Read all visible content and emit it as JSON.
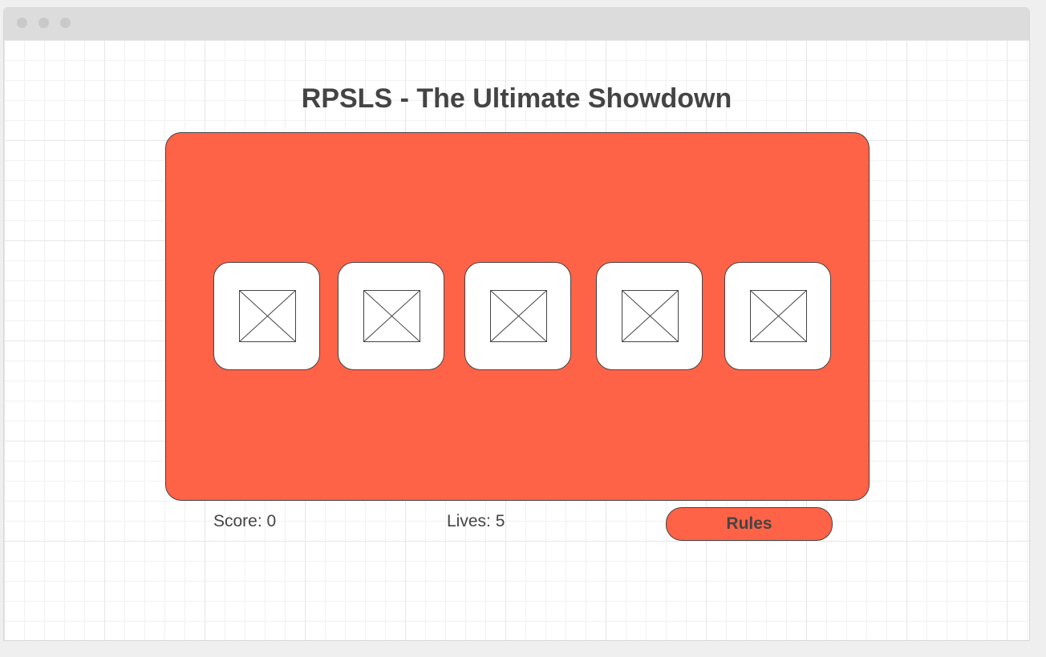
{
  "page": {
    "title": "RPSLS - The Ultimate Showdown"
  },
  "colors": {
    "accent": "#ff6347",
    "text": "#444444",
    "card": "#ffffff"
  },
  "board": {
    "choices": [
      {
        "icon": "image-placeholder-icon"
      },
      {
        "icon": "image-placeholder-icon"
      },
      {
        "icon": "image-placeholder-icon"
      },
      {
        "icon": "image-placeholder-icon"
      },
      {
        "icon": "image-placeholder-icon"
      }
    ]
  },
  "status": {
    "score": "Score: 0",
    "lives": "Lives: 5"
  },
  "actions": {
    "rules_label": "Rules"
  }
}
